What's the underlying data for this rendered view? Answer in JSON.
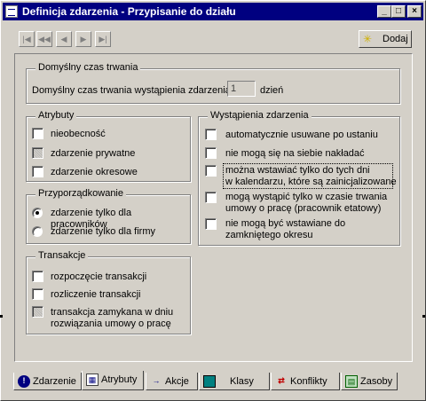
{
  "window": {
    "title": "Definicja zdarzenia - Przypisanie do działu"
  },
  "toolbar": {
    "add_label": "Dodaj"
  },
  "duration": {
    "legend": "Domyślny czas trwania",
    "label": "Domyślny czas trwania wystąpienia zdarzenia:",
    "value": "1",
    "unit": "dzień"
  },
  "attributes": {
    "legend": "Atrybuty",
    "items": [
      {
        "label": "nieobecność",
        "checked": false,
        "disabled": false
      },
      {
        "label": "zdarzenie prywatne",
        "checked": false,
        "disabled": true
      },
      {
        "label": "zdarzenie okresowe",
        "checked": false,
        "disabled": false
      }
    ]
  },
  "assignment": {
    "legend": "Przyporządkowanie",
    "options": [
      {
        "label": "zdarzenie tylko dla pracowników",
        "selected": true
      },
      {
        "label": "zdarzenie tylko dla firmy",
        "selected": false
      }
    ]
  },
  "transactions": {
    "legend": "Transakcje",
    "items": [
      {
        "label": "rozpoczęcie transakcji",
        "checked": false,
        "disabled": false
      },
      {
        "label": "rozliczenie transakcji",
        "checked": false,
        "disabled": false
      },
      {
        "label_line1": "transakcja zamykana w dniu",
        "label_line2": "rozwiązania umowy o pracę",
        "checked": false,
        "disabled": true
      }
    ]
  },
  "occurrences": {
    "legend": "Wystąpienia zdarzenia",
    "items": [
      {
        "label_line1": "automatycznie usuwane po ustaniu",
        "label_line2": "",
        "checked": false
      },
      {
        "label_line1": "nie mogą się na siebie nakładać",
        "label_line2": "",
        "checked": false
      },
      {
        "label_line1": "można wstawiać tylko do tych dni",
        "label_line2": "w kalendarzu, które są zainicjalizowane",
        "checked": false,
        "focused": true
      },
      {
        "label_line1": "mogą wystąpić tylko w czasie trwania",
        "label_line2": "umowy o pracę (pracownik etatowy)",
        "checked": false
      },
      {
        "label_line1": "nie mogą być wstawiane do",
        "label_line2": "zamkniętego okresu",
        "checked": false
      }
    ]
  },
  "tabs": [
    {
      "label": "Zdarzenie",
      "icon": "info-icon",
      "active": false
    },
    {
      "label": "Atrybuty",
      "icon": "attributes-icon",
      "active": true
    },
    {
      "label": "Akcje",
      "icon": "actions-icon",
      "active": false
    },
    {
      "label": "Klasy",
      "icon": "classes-icon",
      "active": false
    },
    {
      "label": "Konflikty",
      "icon": "conflicts-icon",
      "active": false
    },
    {
      "label": "Zasoby",
      "icon": "resources-icon",
      "active": false
    }
  ]
}
